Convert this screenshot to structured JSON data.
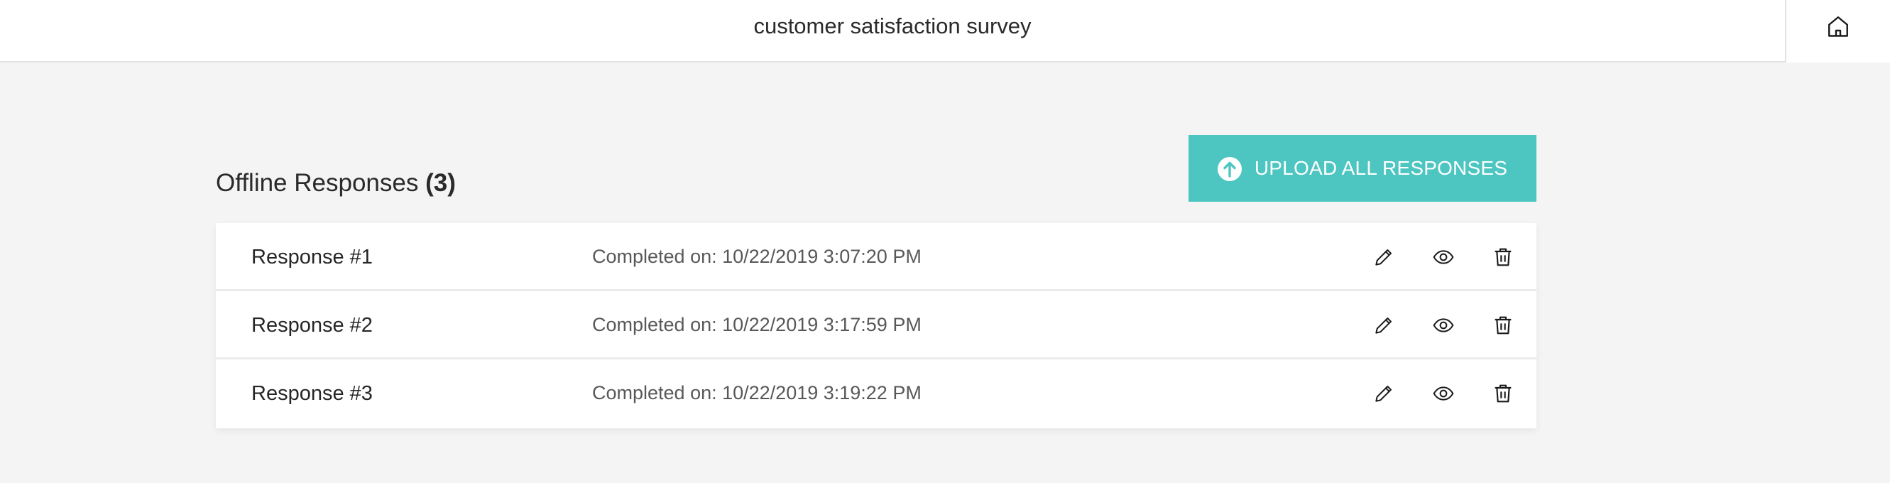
{
  "header": {
    "title": "customer satisfaction survey",
    "home_icon": "home-icon"
  },
  "section": {
    "title": "Offline Responses",
    "count": "(3)"
  },
  "upload_button": {
    "label": "UPLOAD ALL RESPONSES",
    "icon": "upload-circle-arrow-icon",
    "color": "#4dc5c1"
  },
  "responses": [
    {
      "name": "Response #1",
      "completed": "Completed on: 10/22/2019 3:07:20 PM"
    },
    {
      "name": "Response #2",
      "completed": "Completed on: 10/22/2019 3:17:59 PM"
    },
    {
      "name": "Response #3",
      "completed": "Completed on: 10/22/2019 3:19:22 PM"
    }
  ],
  "row_actions": [
    {
      "name": "edit",
      "icon": "pencil-icon"
    },
    {
      "name": "view",
      "icon": "eye-icon"
    },
    {
      "name": "delete",
      "icon": "trash-icon"
    }
  ]
}
